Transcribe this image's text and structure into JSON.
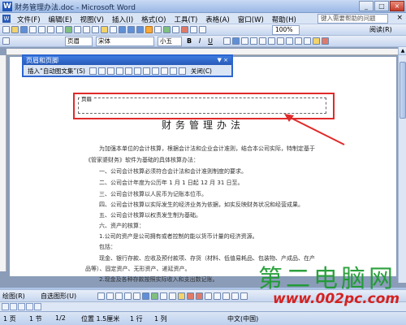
{
  "window": {
    "title": "财务管理办法.doc - Microsoft Word",
    "controls": [
      "_",
      "□",
      "×"
    ]
  },
  "menu": {
    "items": [
      "文件(F)",
      "编辑(E)",
      "视图(V)",
      "插入(I)",
      "格式(O)",
      "工具(T)",
      "表格(A)",
      "窗口(W)",
      "帮助(H)"
    ],
    "help_placeholder": "键入需要帮助的问题",
    "close": "×"
  },
  "toolbar": {
    "zoom": "100%",
    "read_label": "阅读(R)"
  },
  "format_toolbar": {
    "style": "页眉",
    "font": "宋体",
    "size": "小五",
    "bold": "B",
    "italic": "I",
    "underline": "U"
  },
  "header_footer_toolbar": {
    "title": "页眉和页脚",
    "insert_autotext": "插入“自动图文集”(S)",
    "close": "关闭(C)"
  },
  "document": {
    "header_label": "页眉",
    "title": "财务管理办法",
    "paragraphs": [
      "为加强本单位的会计核算，根据会计法和企业会计准则，结合本公司实际，特制定基于",
      "《管家婆财务》软件为基础的具体核算办法：",
      "一、公司会计核算必须符合会计法和会计准则制度的要求。",
      "二、公司会计年度为公历年 1 月 1 日起 12 月 31 日至。",
      "三、公司会计核算以人民币为记账本位币。",
      "四、公司会计核算以实际发生的经济业务为依据，如实反映财务状况和经营成果。",
      "五、公司会计核算以权责发生制为基础。",
      "六、资产的核算：",
      "1.公司的资产是公司拥有或者控制的能以货币计量的经济资源。",
      "包括：",
      "现金、银行存款、应收及预付款项、存货（材料、低值易耗品、包装物、产成品、在产",
      "品等）、固定资产、无形资产、递延资产。",
      "2.现金及各种存款按照实际收入和支出数记账。"
    ]
  },
  "drawing_toolbar": {
    "draw": "绘图(R)",
    "autoshapes": "自选图形(U)"
  },
  "status": {
    "page": "1 页",
    "section": "1 节",
    "pages": "1/2",
    "position": "位置 1.5厘米",
    "line": "1 行",
    "column": "1 列",
    "language": "中文(中国)"
  },
  "watermark": {
    "text": "第二电脑网",
    "url": "www.002pc.com"
  },
  "colors": {
    "highlight_red": "#e02a2a",
    "title_blue": "#2c66cf",
    "watermark_green": "#1b9a2e"
  }
}
